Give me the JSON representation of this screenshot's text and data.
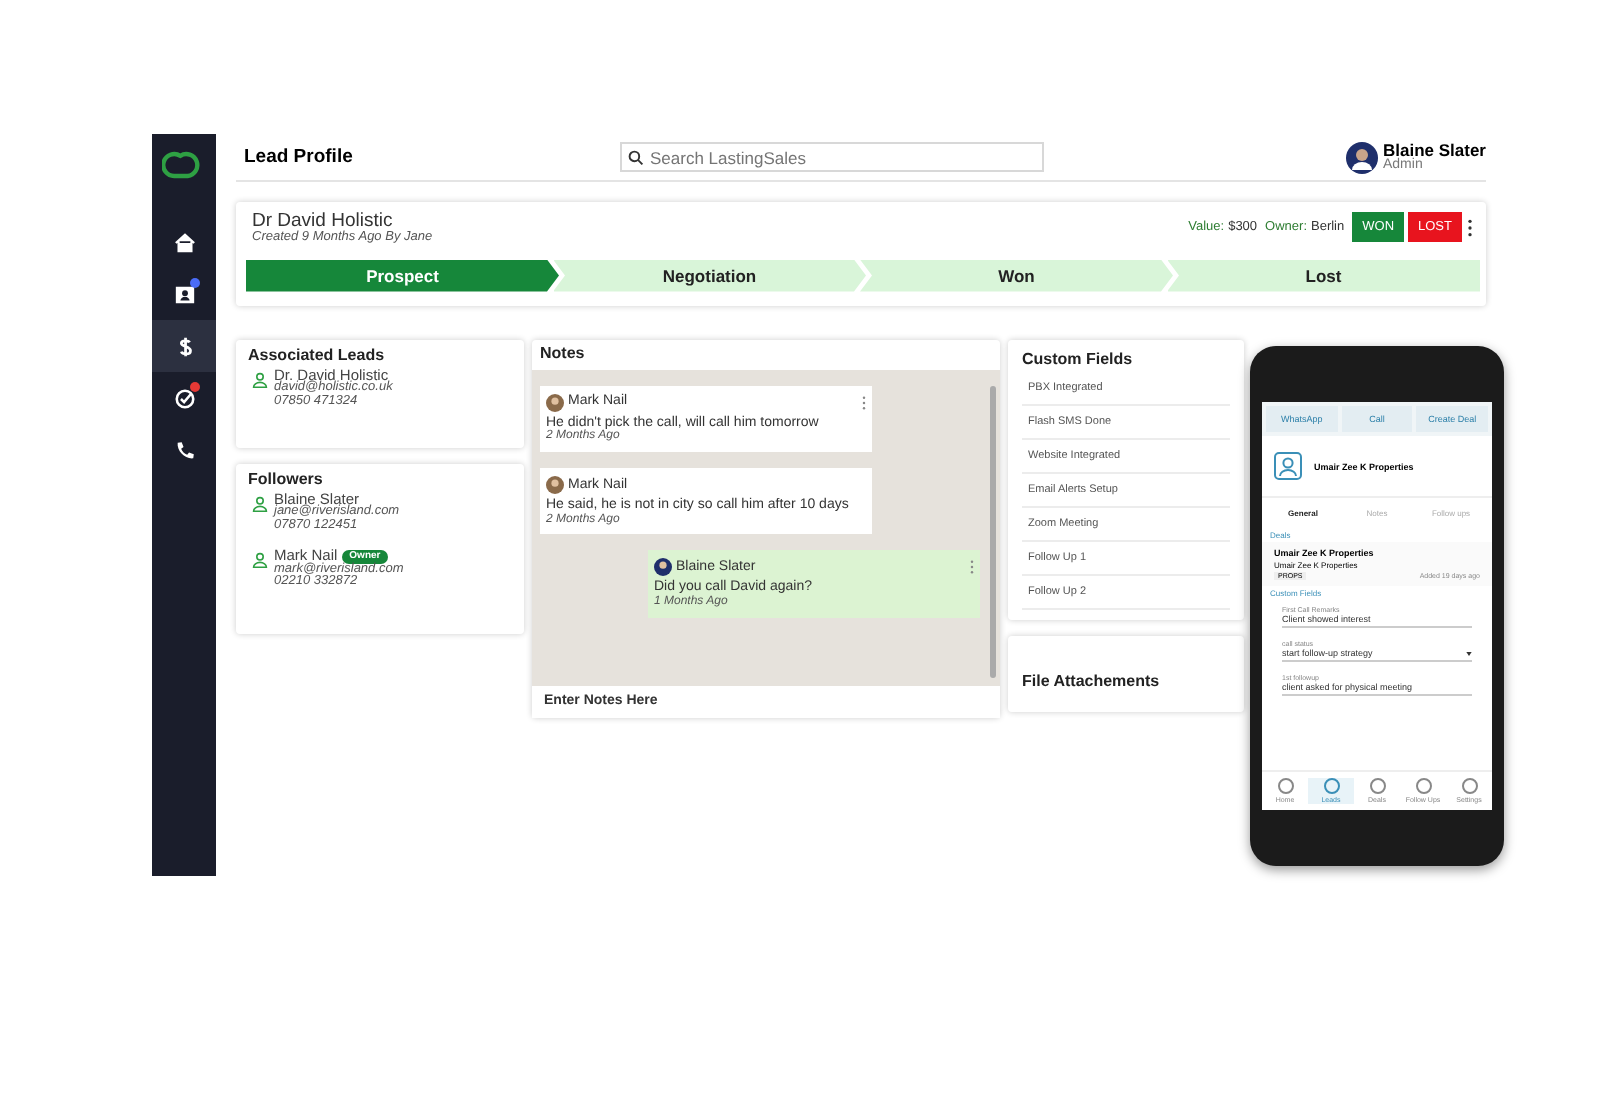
{
  "header": {
    "title": "Lead Profile",
    "search": {
      "placeholder": "Search LastingSales"
    },
    "user": {
      "name": "Blaine Slater",
      "role": "Admin"
    }
  },
  "sidebar": {
    "items": [
      {
        "kind": "home",
        "selected": false,
        "badge": false
      },
      {
        "kind": "contacts",
        "selected": false,
        "badge": true
      },
      {
        "kind": "dollar",
        "selected": true,
        "badge": false
      },
      {
        "kind": "tasks",
        "selected": false,
        "badge": true
      },
      {
        "kind": "phone",
        "selected": false,
        "badge": false
      }
    ]
  },
  "lead": {
    "name": "Dr David Holistic",
    "created": "Created 9 Months Ago By Jane",
    "value_label": "Value:",
    "value": "$300",
    "owner_label": "Owner:",
    "owner": "Berlin",
    "buttons": [
      {
        "kind": "won",
        "label": "WON"
      },
      {
        "kind": "lost",
        "label": "LOST"
      }
    ],
    "stages": [
      {
        "label": "Prospect",
        "selected": true
      },
      {
        "label": "Negotiation",
        "selected": false
      },
      {
        "label": "Won",
        "selected": false
      },
      {
        "label": "Lost",
        "selected": false
      }
    ]
  },
  "associated_leads": {
    "title": "Associated Leads",
    "items": [
      {
        "name": "Dr. David Holistic",
        "email": "david@holistic.co.uk",
        "phone": "07850 471324"
      }
    ]
  },
  "followers": {
    "title": "Followers",
    "items": [
      {
        "name": "Blaine Slater",
        "email": "jane@riverisland.com",
        "phone": "07870 122451"
      },
      {
        "name": "Mark Nail",
        "badge": "Owner",
        "email": "mark@riverisland.com",
        "phone": "02210 332872"
      }
    ]
  },
  "notes": {
    "title": "Notes",
    "items": [
      {
        "author": "Mark Nail",
        "text": "He didn't pick the call, will call him tomorrow",
        "time": "2 Months Ago",
        "own": false,
        "menu": true
      },
      {
        "author": "Mark Nail",
        "text": "He said, he is not in city so call him after 10 days",
        "time": "2 Months Ago",
        "own": false,
        "menu": false
      },
      {
        "author": "Blaine Slater",
        "text": "Did you call David again?",
        "time": "1 Months Ago",
        "own": true,
        "menu": true
      }
    ],
    "input": {
      "placeholder": "Enter Notes Here"
    }
  },
  "custom_fields": {
    "title": "Custom Fields",
    "items": [
      "PBX Integrated",
      "Flash SMS Done",
      "Website Integrated",
      "Email Alerts Setup",
      "Zoom Meeting",
      "Follow Up 1",
      "Follow Up 2"
    ]
  },
  "file_attachments": {
    "title": "File Attachements"
  },
  "phone": {
    "actions": [
      "WhatsApp",
      "Call",
      "Create Deal"
    ],
    "contact": "Umair Zee K Properties",
    "tabs": [
      {
        "label": "General",
        "selected": true
      },
      {
        "label": "Notes",
        "selected": false
      },
      {
        "label": "Follow ups",
        "selected": false
      }
    ],
    "deals_title": "Deals",
    "deal": {
      "title": "Umair Zee K Properties",
      "company": "Umair Zee K Properties",
      "tag": "PROPS",
      "added": "Added 19 days ago"
    },
    "custom_fields_title": "Custom Fields",
    "fields": [
      {
        "label": "First Call Remarks",
        "value": "Client showed interest",
        "dropdown": false
      },
      {
        "label": "call status",
        "value": "start follow-up strategy",
        "dropdown": true
      },
      {
        "label": "1st followup",
        "value": "client asked for physical meeting",
        "dropdown": false
      }
    ],
    "nav": [
      {
        "label": "Home",
        "selected": false
      },
      {
        "label": "Leads",
        "selected": true
      },
      {
        "label": "Deals",
        "selected": false
      },
      {
        "label": "Follow Ups",
        "selected": false
      },
      {
        "label": "Settings",
        "selected": false
      }
    ]
  }
}
